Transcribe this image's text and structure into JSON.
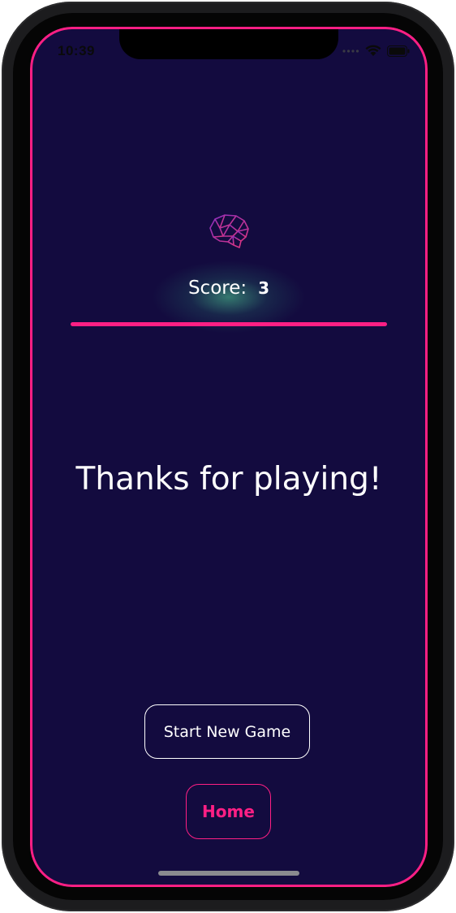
{
  "status_bar": {
    "time": "10:39",
    "icons": [
      "cellular-dots-icon",
      "wifi-icon",
      "battery-icon"
    ]
  },
  "header": {
    "logo_icon": "brain-icon",
    "score_label": "Score:",
    "score_value": "3"
  },
  "main": {
    "message": "Thanks for playing!"
  },
  "actions": {
    "start_new_game_label": "Start New Game",
    "home_label": "Home"
  },
  "colors": {
    "background": "#130b3f",
    "accent": "#ff1f84",
    "text": "#ffffff",
    "glow": "#50d296"
  }
}
